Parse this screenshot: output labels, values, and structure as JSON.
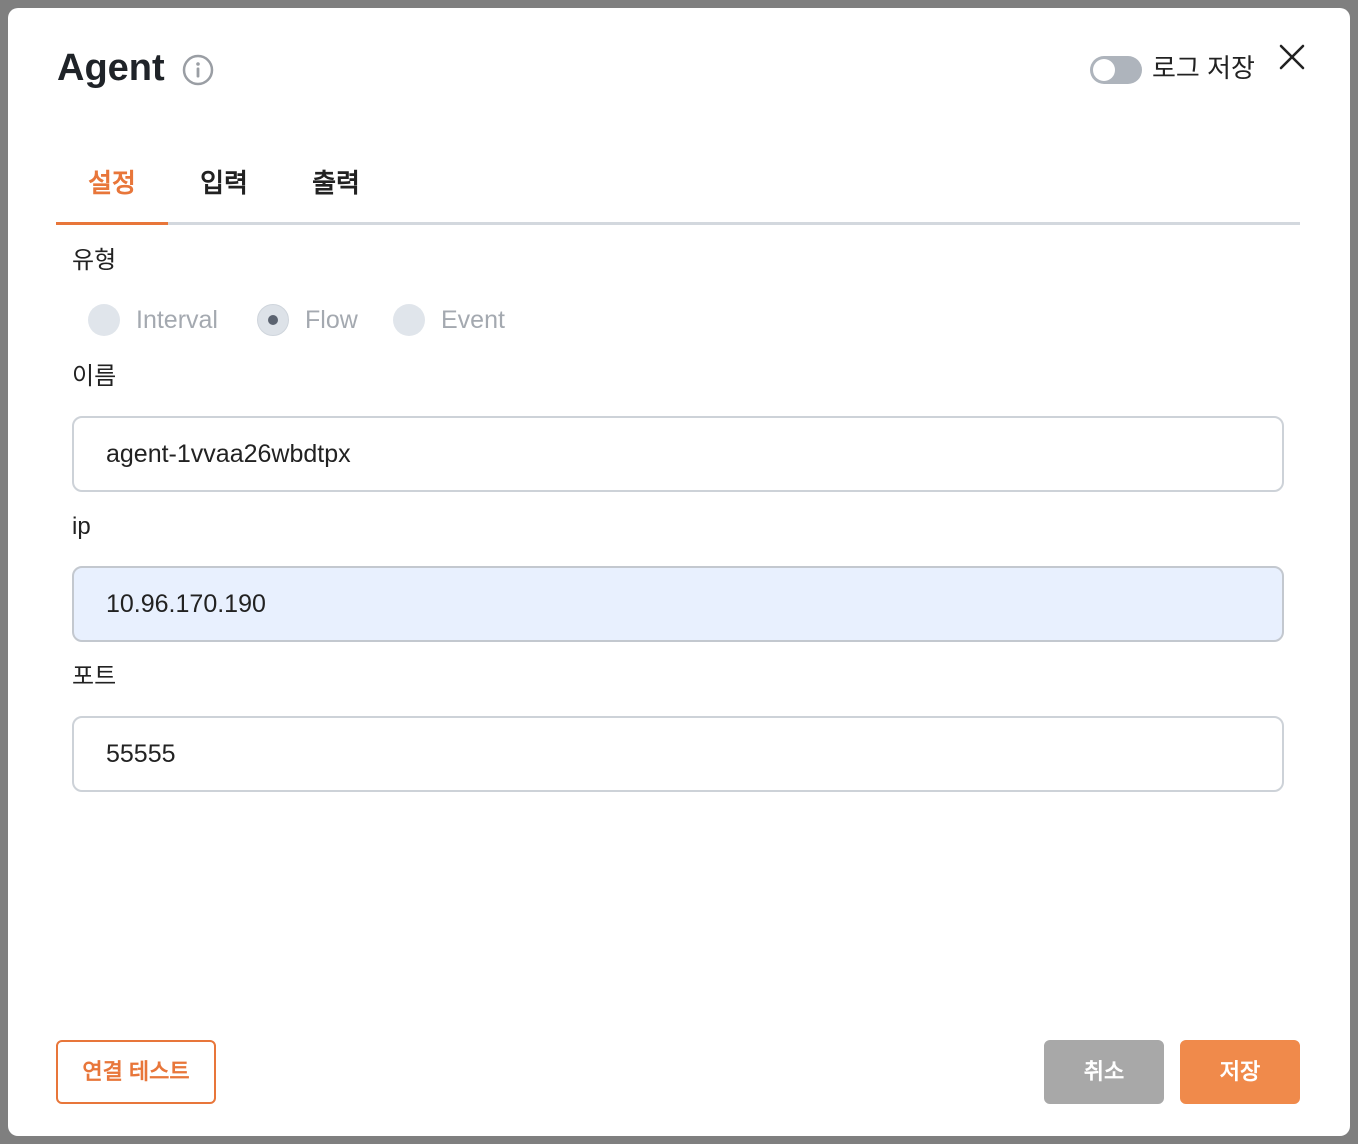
{
  "dialog": {
    "title": "Agent",
    "info_icon": "info-icon",
    "close_icon": "close-icon",
    "log_toggle": {
      "label": "로그 저장",
      "on": false
    }
  },
  "tabs": [
    {
      "label": "설정",
      "active": true
    },
    {
      "label": "입력",
      "active": false
    },
    {
      "label": "출력",
      "active": false
    }
  ],
  "form": {
    "type_label": "유형",
    "type_options": [
      {
        "label": "Interval",
        "selected": false
      },
      {
        "label": "Flow",
        "selected": true
      },
      {
        "label": "Event",
        "selected": false
      }
    ],
    "name_label": "이름",
    "name_value": "agent-1vvaa26wbdtpx",
    "ip_label": "ip",
    "ip_value": "10.96.170.190",
    "port_label": "포트",
    "port_value": "55555"
  },
  "footer": {
    "test_button": "연결 테스트",
    "cancel_button": "취소",
    "save_button": "저장"
  },
  "colors": {
    "accent": "#e8763a",
    "accent_fill": "#f08a4b",
    "cancel_fill": "#a8a8a8",
    "overlay": "#7f7f7f"
  }
}
